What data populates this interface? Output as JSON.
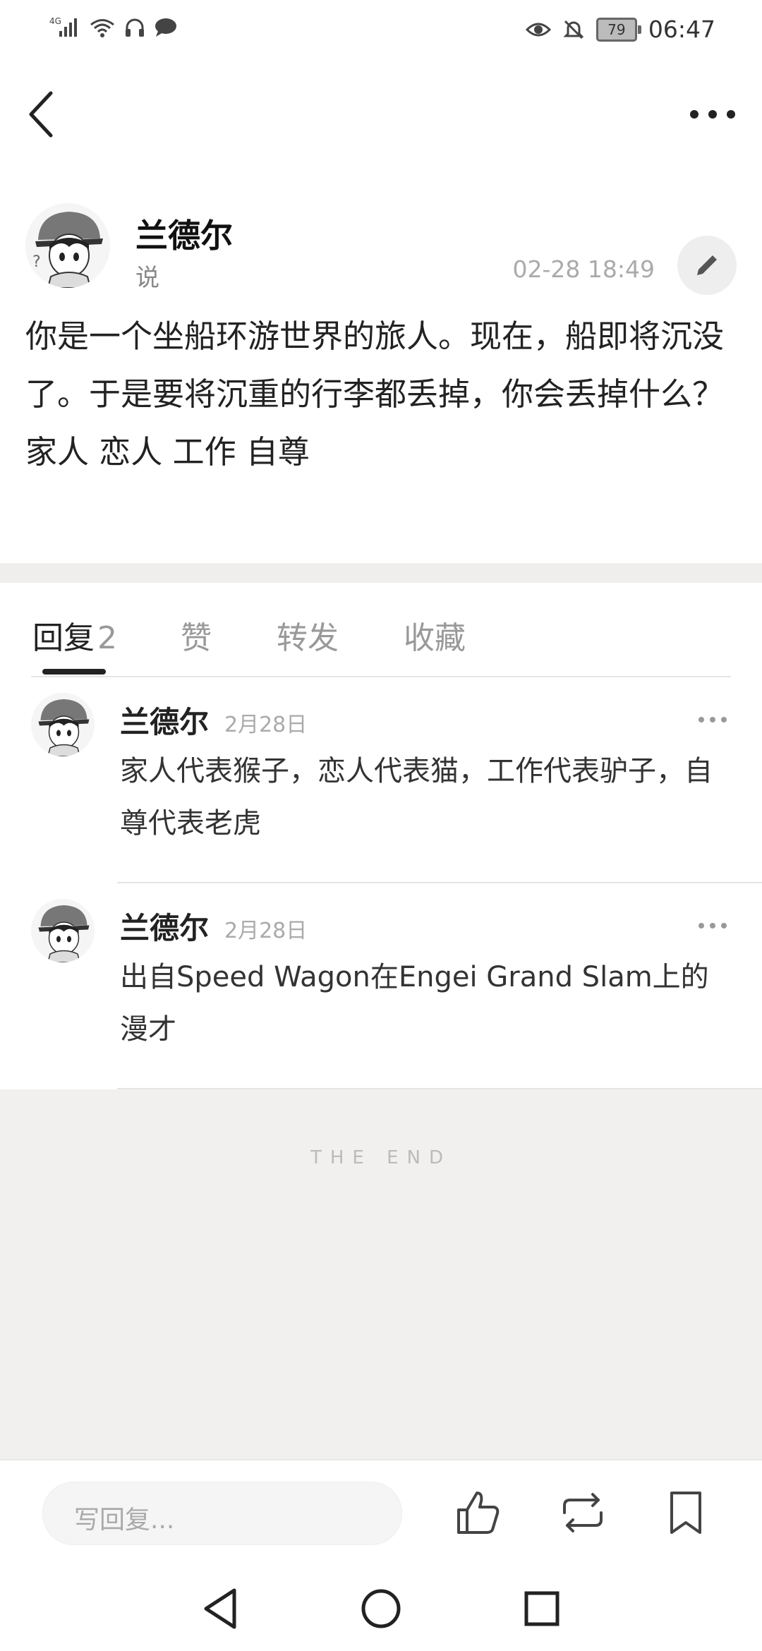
{
  "status_bar": {
    "network": "4G",
    "battery": "79",
    "time": "06:47"
  },
  "post": {
    "author": "兰德尔",
    "verb": "说",
    "time": "02-28 18:49",
    "body_lines": [
      "你是一个坐船环游世界的旅人。现在，船即将沉没了。于是要将沉重的行李都丢掉，你会丢掉什么？",
      "家人 恋人 工作 自尊"
    ]
  },
  "tabs": [
    {
      "label": "回复",
      "count": "2"
    },
    {
      "label": "赞"
    },
    {
      "label": "转发"
    },
    {
      "label": "收藏"
    }
  ],
  "replies": [
    {
      "author": "兰德尔",
      "date": "2月28日",
      "text": "家人代表猴子，恋人代表猫，工作代表驴子，自尊代表老虎"
    },
    {
      "author": "兰德尔",
      "date": "2月28日",
      "text": "出自Speed Wagon在Engei Grand Slam上的漫才"
    }
  ],
  "end_label": "THE END",
  "bottom_bar": {
    "placeholder": "写回复..."
  },
  "icons": [
    "back-icon",
    "more-icon",
    "edit-icon",
    "like-icon",
    "repost-icon",
    "bookmark-icon",
    "nav-back-icon",
    "nav-home-icon",
    "nav-recent-icon"
  ],
  "colors": {
    "background": "#ffffff",
    "band": "#efeeec",
    "end_area": "#f1f0ee",
    "text": "#222222",
    "muted": "#999999"
  }
}
